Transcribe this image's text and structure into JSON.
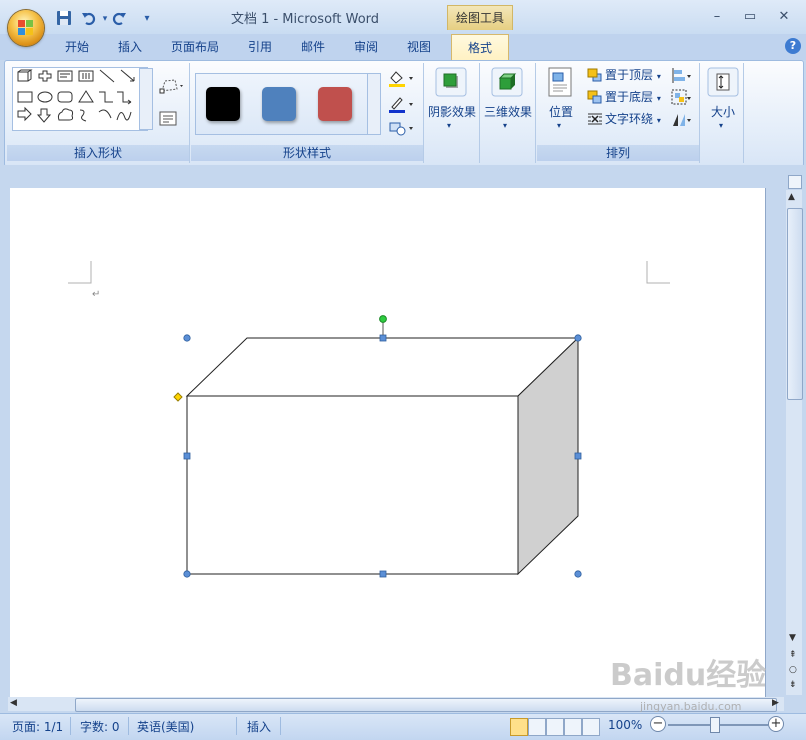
{
  "window": {
    "title": "文档 1 - Microsoft Word",
    "contextual_tab_group": "绘图工具",
    "minimize": "–",
    "restore": "▭",
    "close": "✕"
  },
  "quick_access": {
    "save_icon": "save-icon",
    "undo_icon": "undo-icon",
    "redo_icon": "redo-icon",
    "customize_glyph": "▾"
  },
  "tabs": [
    {
      "label": "开始"
    },
    {
      "label": "插入"
    },
    {
      "label": "页面布局"
    },
    {
      "label": "引用"
    },
    {
      "label": "邮件"
    },
    {
      "label": "审阅"
    },
    {
      "label": "视图"
    }
  ],
  "active_tab": "格式",
  "help_glyph": "?",
  "ribbon": {
    "insert_shapes": {
      "label": "插入形状"
    },
    "shape_styles": {
      "label": "形状样式",
      "swatches": [
        "#000000",
        "#4f81bd",
        "#c0504d"
      ]
    },
    "shadow_effects": {
      "label": "阴影效果"
    },
    "three_d_effects": {
      "label": "三维效果"
    },
    "arrange": {
      "label": "排列",
      "position": "位置",
      "bring_to_front": "置于顶层",
      "send_to_back": "置于底层",
      "text_wrap": "文字环绕"
    },
    "size": {
      "label": "大小"
    }
  },
  "document": {
    "paragraph_mark": "↵"
  },
  "status": {
    "page": "页面: 1/1",
    "words": "字数: 0",
    "language": "英语(美国)",
    "insert_mode": "插入",
    "zoom": "100%"
  },
  "watermark": {
    "brand": "Baidu经验",
    "url": "jingyan.baidu.com"
  },
  "colors": {
    "accent": "#15428b",
    "ribbon_border": "#9ebbe0",
    "handle": "#5b8fd6",
    "rotate_handle": "#2ecc40",
    "adjust_handle": "#ffd400",
    "cube_side": "#d0d0d0"
  }
}
